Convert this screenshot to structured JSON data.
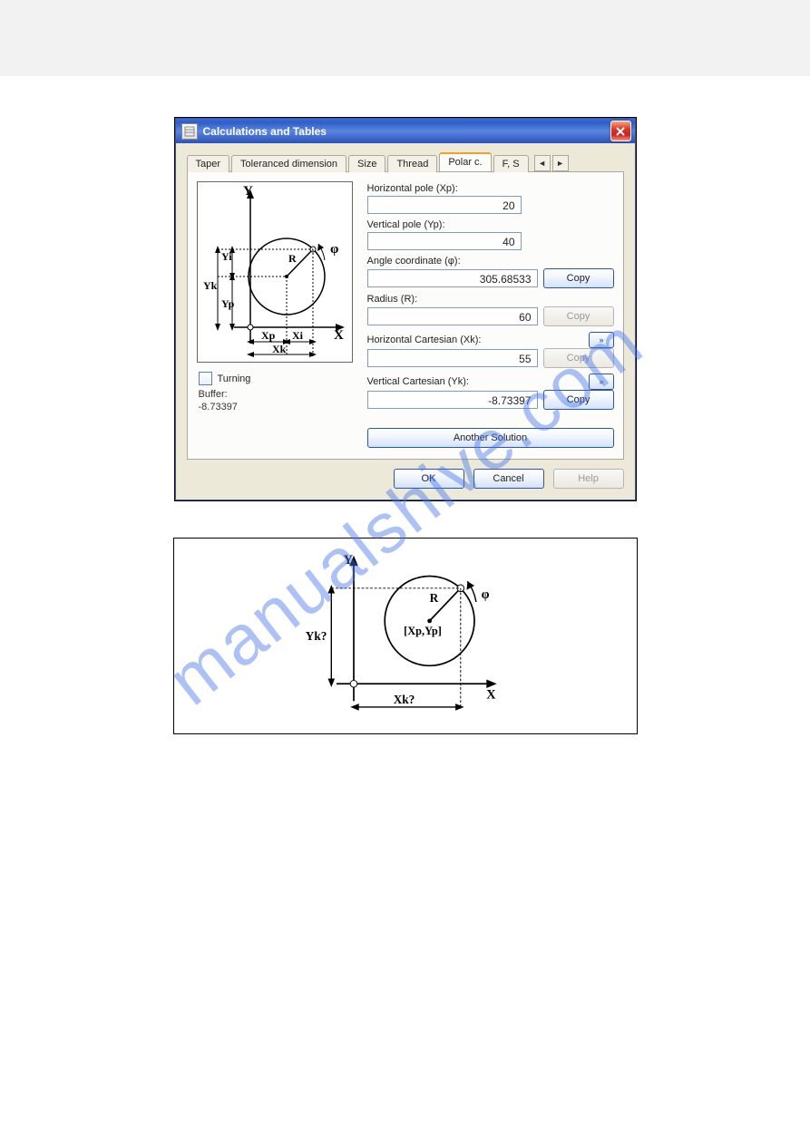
{
  "watermark": "manualshive.com",
  "dialog": {
    "title": "Calculations and Tables",
    "tabs": {
      "taper": "Taper",
      "toleranced": "Toleranced dimension",
      "size": "Size",
      "thread": "Thread",
      "polar": "Polar c.",
      "fs": "F, S"
    },
    "turning_label": "Turning",
    "buffer_label": "Buffer:",
    "buffer_value": "-8.73397",
    "fields": {
      "xp_label": "Horizontal pole (Xp):",
      "xp_value": "20",
      "yp_label": "Vertical pole (Yp):",
      "yp_value": "40",
      "phi_label": "Angle coordinate (φ):",
      "phi_value": "305.68533",
      "r_label": "Radius (R):",
      "r_value": "60",
      "xk_label": "Horizontal Cartesian (Xk):",
      "xk_value": "55",
      "yk_label": "Vertical Cartesian (Yk):",
      "yk_value": "-8.73397"
    },
    "buttons": {
      "copy": "Copy",
      "another": "Another Solution",
      "ok": "OK",
      "cancel": "Cancel",
      "help": "Help"
    },
    "diagram1": {
      "Y": "Y",
      "X": "X",
      "Yi": "Yi",
      "Yk": "Yk",
      "Yp": "Yp",
      "Xp": "Xp",
      "Xi": "Xi",
      "Xk": "Xk",
      "R": "R",
      "phi": "φ"
    }
  },
  "diagram2": {
    "Y": "Y",
    "X": "X",
    "Ykq": "Yk?",
    "Xkq": "Xk?",
    "center": "[Xp,Yp]",
    "R": "R",
    "phi": "φ"
  }
}
